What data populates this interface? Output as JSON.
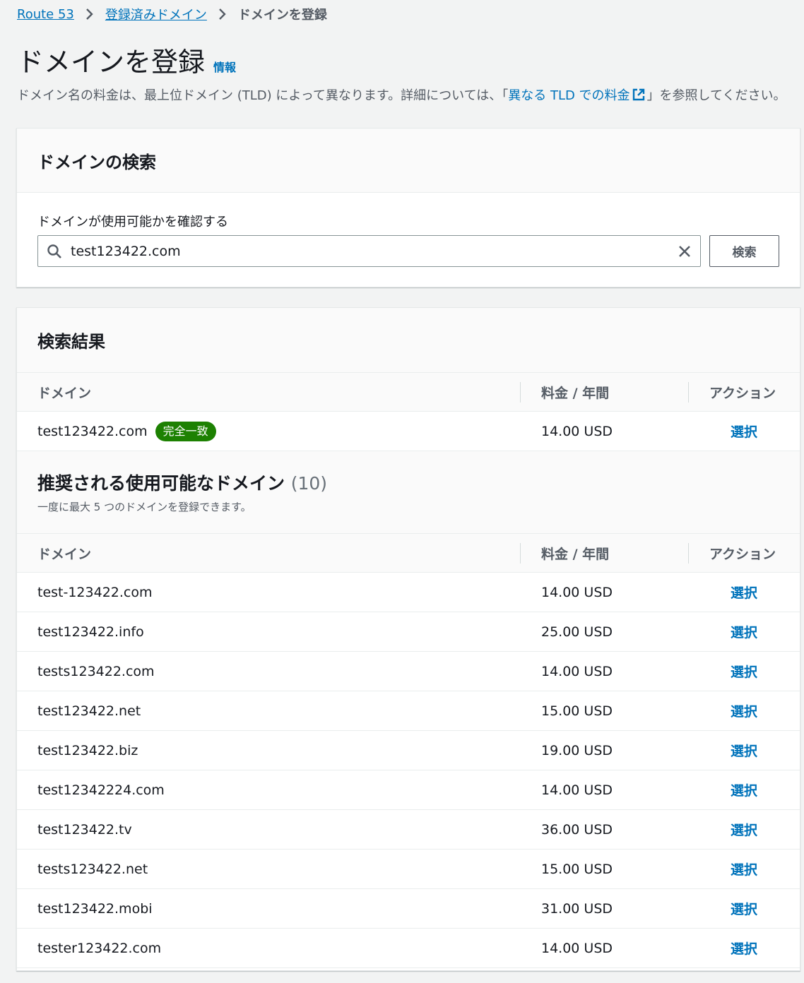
{
  "breadcrumb": {
    "items": [
      "Route 53",
      "登録済みドメイン"
    ],
    "current": "ドメインを登録"
  },
  "page": {
    "title": "ドメインを登録",
    "info_link": "情報",
    "description_before": "ドメイン名の料金は、最上位ドメイン (TLD) によって異なります。詳細については、「",
    "description_link": "異なる TLD での料金",
    "description_after": "」を参照してください。"
  },
  "search_panel": {
    "title": "ドメインの検索",
    "field_label": "ドメインが使用可能かを確認する",
    "input_value": "test123422.com",
    "search_button": "検索"
  },
  "results_panel": {
    "title": "検索結果",
    "columns": {
      "domain": "ドメイン",
      "price": "料金 / 年間",
      "action": "アクション"
    },
    "exact_match": {
      "domain": "test123422.com",
      "badge": "完全一致",
      "price": "14.00 USD",
      "action": "選択"
    },
    "suggested": {
      "title": "推奨される使用可能なドメイン",
      "count": "(10)",
      "subtitle": "一度に最大 5 つのドメインを登録できます。",
      "rows": [
        {
          "domain": "test-123422.com",
          "price": "14.00 USD",
          "action": "選択"
        },
        {
          "domain": "test123422.info",
          "price": "25.00 USD",
          "action": "選択"
        },
        {
          "domain": "tests123422.com",
          "price": "14.00 USD",
          "action": "選択"
        },
        {
          "domain": "test123422.net",
          "price": "15.00 USD",
          "action": "選択"
        },
        {
          "domain": "test123422.biz",
          "price": "19.00 USD",
          "action": "選択"
        },
        {
          "domain": "test12342224.com",
          "price": "14.00 USD",
          "action": "選択"
        },
        {
          "domain": "test123422.tv",
          "price": "36.00 USD",
          "action": "選択"
        },
        {
          "domain": "tests123422.net",
          "price": "15.00 USD",
          "action": "選択"
        },
        {
          "domain": "test123422.mobi",
          "price": "31.00 USD",
          "action": "選択"
        },
        {
          "domain": "tester123422.com",
          "price": "14.00 USD",
          "action": "選択"
        }
      ]
    }
  },
  "icons": {
    "breadcrumb_separator": "chevron-right-icon",
    "external_link": "external-link-icon",
    "search": "search-icon",
    "clear": "close-icon"
  },
  "colors": {
    "link": "#0073bb",
    "badge_success": "#1d8102",
    "background": "#f2f3f3"
  }
}
